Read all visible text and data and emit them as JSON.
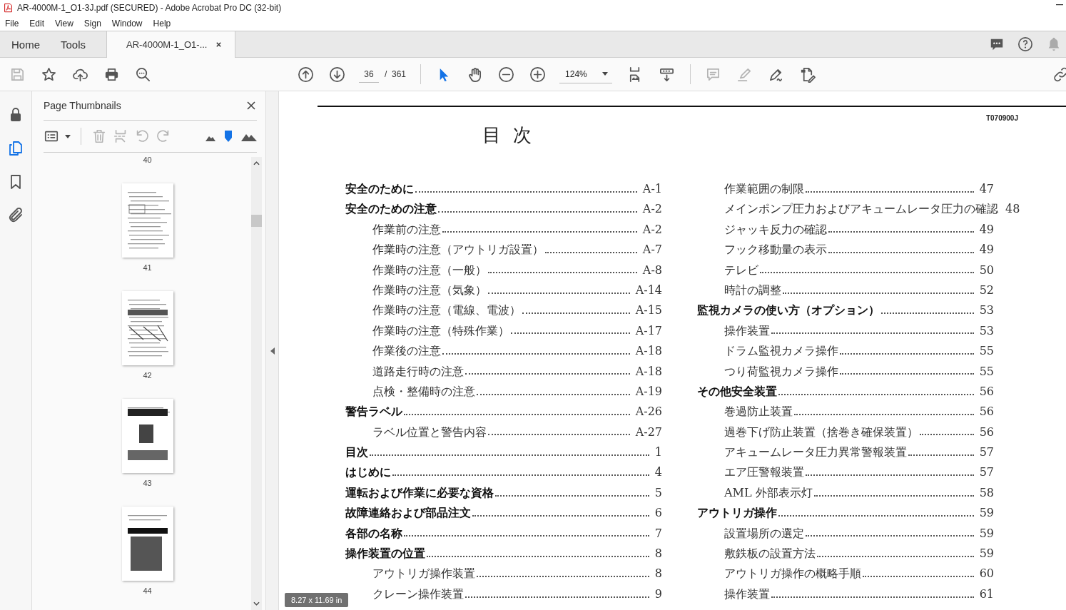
{
  "window": {
    "title": "AR-4000M-1_O1-3J.pdf (SECURED) - Adobe Acrobat Pro DC (32-bit)"
  },
  "menu": [
    "File",
    "Edit",
    "View",
    "Sign",
    "Window",
    "Help"
  ],
  "tabs": [
    {
      "label": "Home",
      "selected": false
    },
    {
      "label": "Tools",
      "selected": false
    },
    {
      "label": "AR-4000M-1_O1-...",
      "selected": true
    }
  ],
  "toolbar": {
    "tools": [
      {
        "disabled": true
      },
      {
        "disabled": false
      },
      {
        "disabled": false
      },
      {
        "disabled": false
      },
      {
        "disabled": false
      },
      {
        "disabled": false
      },
      {
        "disabled": false
      },
      {
        "disabled": false
      },
      {
        "disabled": false
      },
      {
        "disabled": false
      },
      {
        "disabled": false
      },
      {
        "disabled": true
      },
      {
        "disabled": true
      },
      {
        "disabled": false
      },
      {
        "disabled": false
      },
      {
        "disabled": false
      }
    ],
    "cursor_modes": [
      {
        "selected": true
      },
      {
        "selected": false
      }
    ],
    "page": "36",
    "page_total": "/  361",
    "zoom": "124%"
  },
  "sidebar": {
    "items": [
      {
        "selected": false
      },
      {
        "selected": true
      },
      {
        "selected": false
      },
      {
        "selected": false
      }
    ]
  },
  "panel": {
    "title": "Page Thumbnails",
    "tools": [
      {
        "disabled": false
      },
      {
        "disabled": true
      },
      {
        "disabled": true
      },
      {
        "disabled": true
      },
      {
        "disabled": true
      }
    ],
    "thumbnail_size": {
      "level": 0.5
    },
    "top_label": "40",
    "thumbnails": [
      {
        "label": "41"
      },
      {
        "label": "42"
      },
      {
        "label": "43"
      },
      {
        "label": "44"
      }
    ]
  },
  "document": {
    "code": "T070900J",
    "title": "目  次",
    "columns": [
      {
        "sections": [
          {
            "text": "安全のために",
            "page": "A-1"
          },
          {
            "text": "安全のための注意",
            "page": "A-2",
            "children": [
              {
                "text": "作業前の注意",
                "page": "A-2"
              },
              {
                "text": "作業時の注意（アウトリガ設置）",
                "page": "A-7"
              },
              {
                "text": "作業時の注意（一般）",
                "page": "A-8"
              },
              {
                "text": "作業時の注意（気象）",
                "page": "A-14"
              },
              {
                "text": "作業時の注意（電線、電波）",
                "page": "A-15"
              },
              {
                "text": "作業時の注意（特殊作業）",
                "page": "A-17"
              },
              {
                "text": "作業後の注意",
                "page": "A-18"
              },
              {
                "text": "道路走行時の注意",
                "page": "A-18"
              },
              {
                "text": "点検・整備時の注意",
                "page": "A-19"
              }
            ]
          },
          {
            "text": "警告ラベル",
            "page": "A-26",
            "children": [
              {
                "text": "ラベル位置と警告内容",
                "page": "A-27"
              }
            ]
          },
          {
            "text": "目次",
            "page": "1"
          },
          {
            "text": "はじめに",
            "page": "4"
          },
          {
            "text": "運転および作業に必要な資格",
            "page": "5"
          },
          {
            "text": "故障連絡および部品注文",
            "page": "6"
          },
          {
            "text": "各部の名称",
            "page": "7"
          },
          {
            "text": "操作装置の位置",
            "page": "8",
            "children": [
              {
                "text": "アウトリガ操作装置",
                "page": "8"
              },
              {
                "text": "クレーン操作装置",
                "page": "9"
              }
            ]
          }
        ]
      },
      {
        "continued": [
          {
            "text": "作業範囲の制限",
            "page": "47"
          },
          {
            "text": "メインポンプ圧力およびアキュームレータ圧力の確認",
            "page": "48"
          },
          {
            "text": "ジャッキ反力の確認",
            "page": "49"
          },
          {
            "text": "フック移動量の表示",
            "page": "49"
          },
          {
            "text": "テレビ",
            "page": "50"
          },
          {
            "text": "時計の調整",
            "page": "52"
          }
        ],
        "sections": [
          {
            "text": "監視カメラの使い方（オプション）",
            "page": "53",
            "children": [
              {
                "text": "操作装置",
                "page": "53"
              },
              {
                "text": "ドラム監視カメラ操作",
                "page": "55"
              },
              {
                "text": "つり荷監視カメラ操作",
                "page": "55"
              }
            ]
          },
          {
            "text": "その他安全装置",
            "page": "56",
            "children": [
              {
                "text": "巻過防止装置",
                "page": "56"
              },
              {
                "text": "過巻下げ防止装置（捨巻き確保装置）",
                "page": "56"
              },
              {
                "text": "アキュームレータ圧力異常警報装置",
                "page": "57"
              },
              {
                "text": "エア圧警報装置",
                "page": "57"
              },
              {
                "text": "AML  外部表示灯",
                "page": "58"
              }
            ]
          },
          {
            "text": "アウトリガ操作",
            "page": "59",
            "children": [
              {
                "text": "設置場所の選定",
                "page": "59"
              },
              {
                "text": "敷鉄板の設置方法",
                "page": "59"
              },
              {
                "text": "アウトリガ操作の概略手順",
                "page": "60"
              },
              {
                "text": "操作装置",
                "page": "61"
              }
            ]
          }
        ]
      }
    ]
  },
  "page_size": "8.27 x 11.69 in"
}
